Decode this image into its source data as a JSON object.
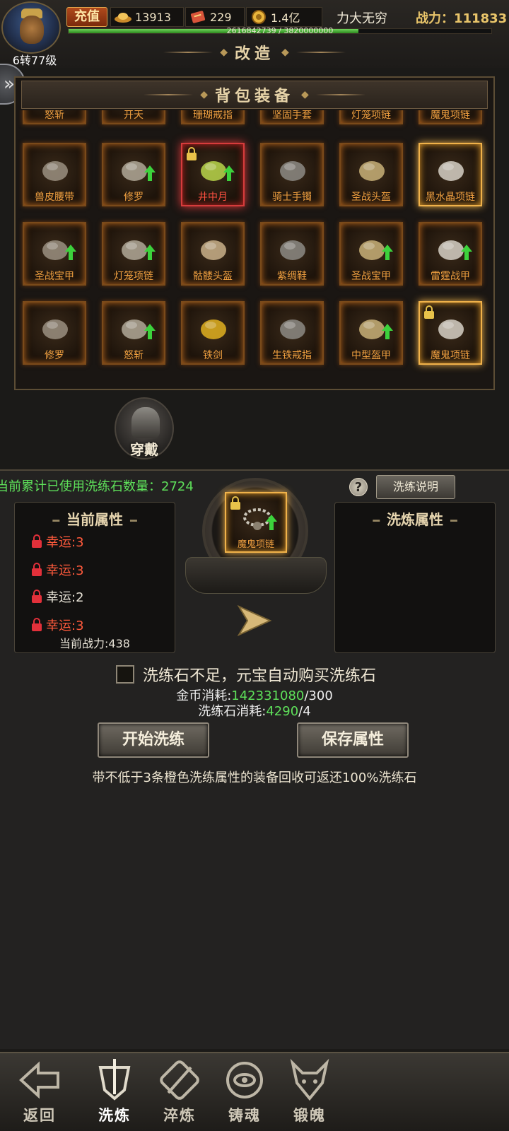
{
  "hud": {
    "level": "6转77级",
    "recharge_label": "充值",
    "ingot": "13913",
    "ticket": "229",
    "gold": "1.4亿",
    "player_name": "力大无穷",
    "power": "战力：111833",
    "exp_text": "2616842739 / 3820000000",
    "exp_fraction": 0.685
  },
  "page_title": "改造",
  "bag": {
    "title": "背包装备",
    "rows": [
      [
        "怒斩",
        "开天",
        "珊瑚戒指",
        "坚固手套",
        "灯笼项链",
        "魔鬼项链"
      ],
      [
        "兽皮腰带",
        "修罗",
        "井中月",
        "骑士手镯",
        "圣战头盔",
        "黑水晶项链"
      ],
      [
        "圣战宝甲",
        "灯笼项链",
        "骷髅头盔",
        "紫绸鞋",
        "圣战宝甲",
        "雷霆战甲"
      ],
      [
        "修罗",
        "怒斩",
        "铁剑",
        "生铁戒指",
        "中型盔甲",
        "魔鬼项链"
      ]
    ]
  },
  "wear_label": "穿戴",
  "refine": {
    "stone_count_text": "当前累计已使用洗练石数量：2724",
    "help_symbol": "?",
    "desc_button": "洗练说明",
    "current_title": "当前属性",
    "new_title": "洗炼属性",
    "dash": "━",
    "attributes": [
      "幸运:3",
      "幸运:3",
      "幸运:2",
      "幸运:3"
    ],
    "current_power": "当前战力:438",
    "selected_item": "魔鬼项链",
    "auto_buy_text": "洗练石不足，元宝自动购买洗练石",
    "gold_cost_label": "金币消耗:",
    "gold_cost_have": "142331080",
    "gold_cost_need": "/300",
    "stone_cost_label": "洗练石消耗:",
    "stone_cost_have": "4290",
    "stone_cost_need": "/4",
    "start_button": "开始洗练",
    "save_button": "保存属性",
    "tip": "带不低于3条橙色洗练属性的装备回收可返还100%洗练石"
  },
  "tabs": {
    "back": "返回",
    "refine": "洗炼",
    "temper": "淬炼",
    "soul": "铸魂",
    "forge": "锻魄"
  }
}
